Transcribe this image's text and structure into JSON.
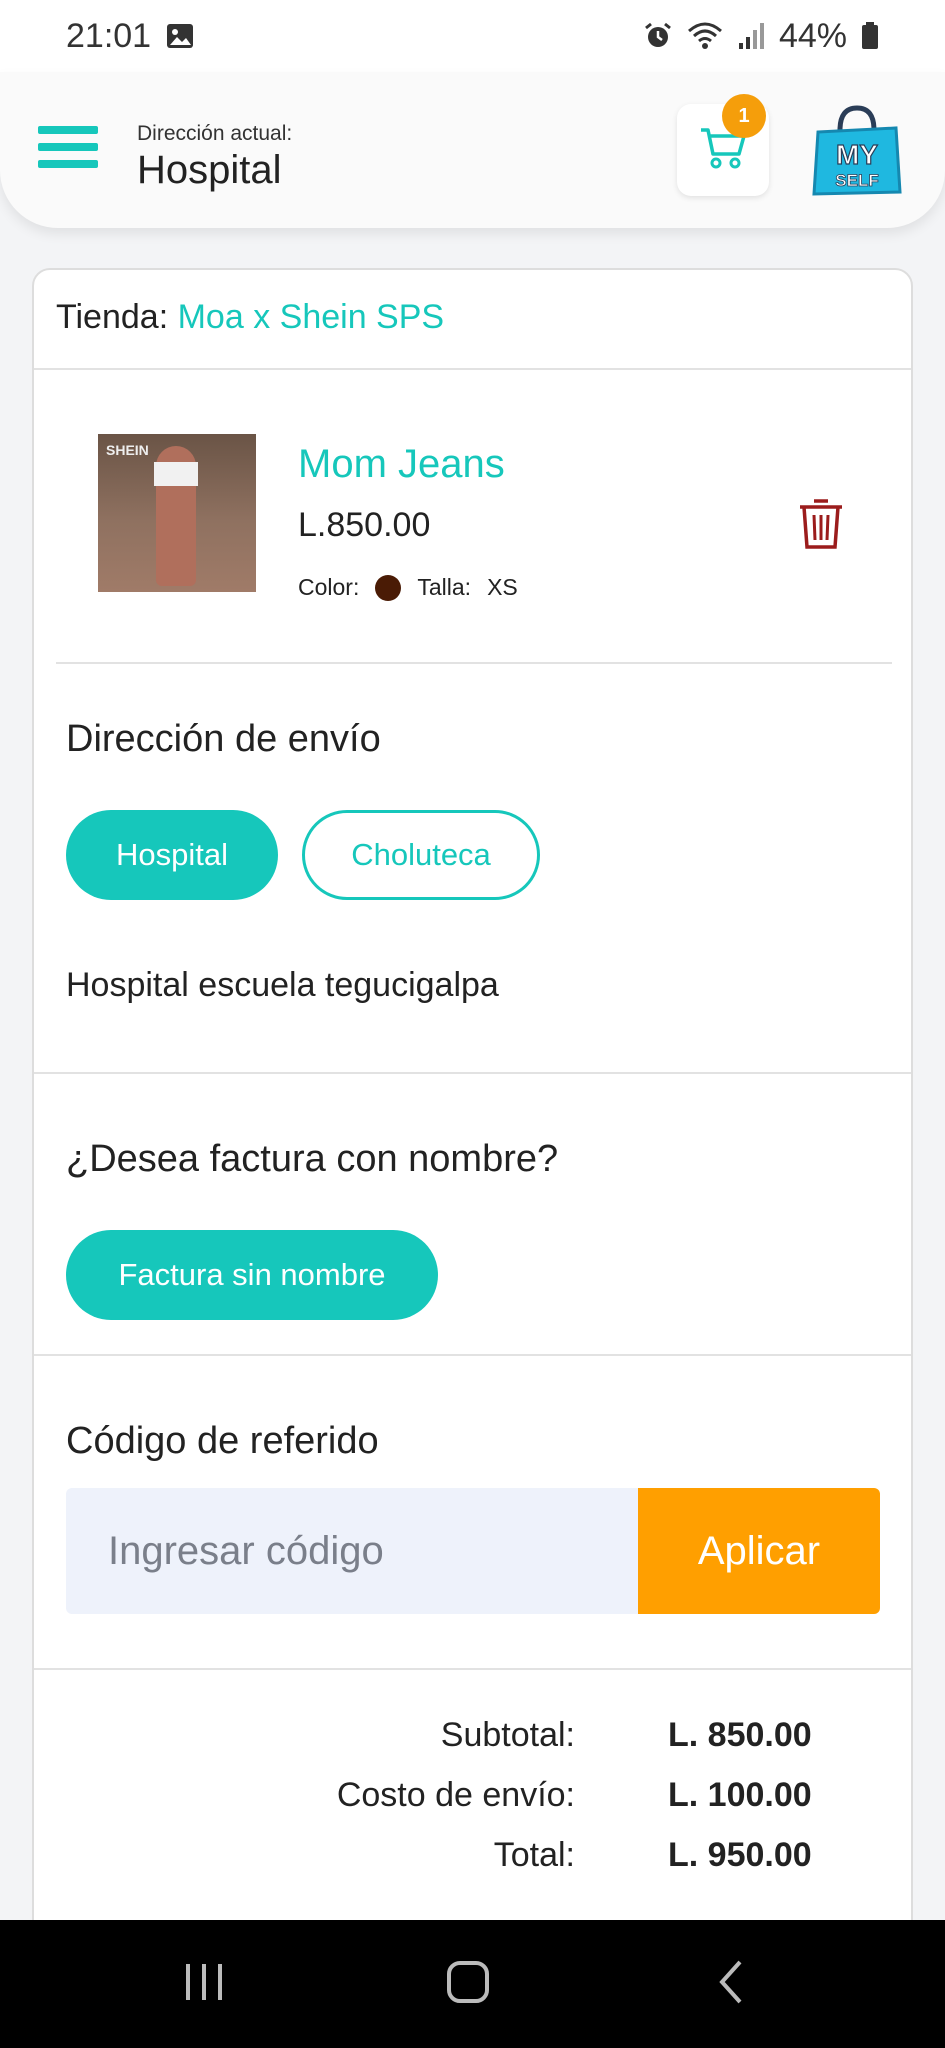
{
  "status_bar": {
    "time": "21:01",
    "battery": "44%",
    "icons": [
      "image-icon",
      "alarm-icon",
      "wifi-icon",
      "signal-icon",
      "battery-icon"
    ]
  },
  "header": {
    "address_label": "Dirección actual:",
    "address_value": "Hospital",
    "cart_count": "1",
    "logo_text": "MY SELF"
  },
  "store": {
    "label": "Tienda:",
    "name": "Moa x Shein SPS"
  },
  "product": {
    "name": "Mom Jeans",
    "price": "L.850.00",
    "color_label": "Color:",
    "color_hex": "#4a1b05",
    "size_label": "Talla:",
    "size_value": "XS",
    "image_text": "SHEIN"
  },
  "shipping": {
    "title": "Dirección de envío",
    "options": [
      "Hospital",
      "Choluteca"
    ],
    "selected": "Hospital",
    "description": "Hospital escuela tegucigalpa"
  },
  "invoice": {
    "title": "¿Desea factura con nombre?",
    "option": "Factura sin nombre"
  },
  "referral": {
    "title": "Código de referido",
    "placeholder": "Ingresar código",
    "value": "",
    "apply_label": "Aplicar"
  },
  "totals": {
    "subtotal_label": "Subtotal:",
    "subtotal_value": "L. 850.00",
    "shipping_label": "Costo de envío:",
    "shipping_value": "L. 100.00",
    "total_label": "Total:",
    "total_value": "L. 950.00"
  },
  "colors": {
    "accent": "#16c7bb",
    "apply": "#ff9f00",
    "badge": "#f59e0b",
    "trash": "#9b1c1c"
  }
}
